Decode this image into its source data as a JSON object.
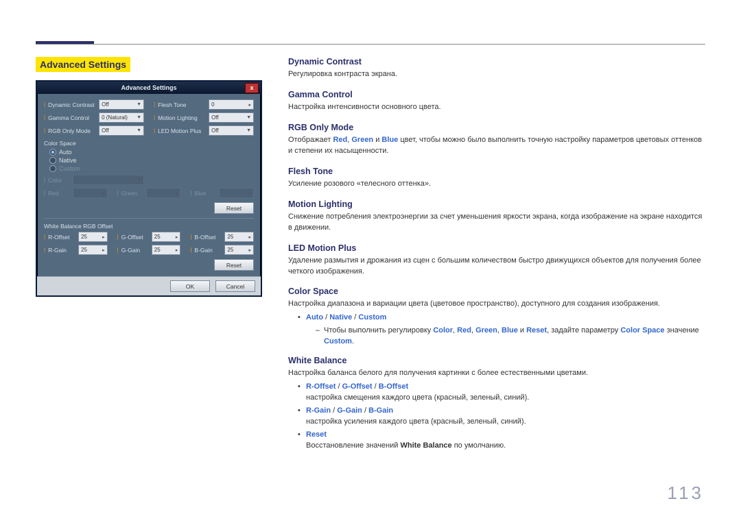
{
  "page_number": "113",
  "section_title": "Advanced Settings",
  "dialog": {
    "title": "Advanced Settings",
    "close": "x",
    "fields": {
      "dynamic_contrast": {
        "label": "Dynamic Contrast",
        "value": "Off"
      },
      "flesh_tone": {
        "label": "Flesh Tone",
        "value": "0"
      },
      "gamma_control": {
        "label": "Gamma Control",
        "value": "0 (Natural)"
      },
      "motion_lighting": {
        "label": "Motion Lighting",
        "value": "Off"
      },
      "rgb_only_mode": {
        "label": "RGB Only Mode",
        "value": "Off"
      },
      "led_motion_plus": {
        "label": "LED Motion Plus",
        "value": "Off"
      }
    },
    "color_space": {
      "header": "Color Space",
      "auto": "Auto",
      "native": "Native",
      "custom": "Custom",
      "color_label": "Color",
      "red_label": "Red",
      "green_label": "Green",
      "blue_label": "Blue",
      "reset": "Reset"
    },
    "white_balance": {
      "header": "White Balance RGB Offset",
      "r_offset": {
        "label": "R-Offset",
        "value": "25"
      },
      "g_offset": {
        "label": "G-Offset",
        "value": "25"
      },
      "b_offset": {
        "label": "B-Offset",
        "value": "25"
      },
      "r_gain": {
        "label": "R-Gain",
        "value": "25"
      },
      "g_gain": {
        "label": "G-Gain",
        "value": "25"
      },
      "b_gain": {
        "label": "B-Gain",
        "value": "25"
      },
      "reset": "Reset"
    },
    "ok": "OK",
    "cancel": "Cancel"
  },
  "descriptions": {
    "dynamic_contrast": {
      "title": "Dynamic Contrast",
      "text": "Регулировка контраста экрана."
    },
    "gamma_control": {
      "title": "Gamma Control",
      "text": "Настройка интенсивности основного цвета."
    },
    "rgb_only": {
      "title": "RGB Only Mode",
      "pre": "Отображает ",
      "red": "Red",
      "sep1": ", ",
      "green": "Green",
      "sep2": " и ",
      "blue": "Blue",
      "post": " цвет, чтобы можно было выполнить точную настройку параметров цветовых оттенков и степени их насыщенности."
    },
    "flesh_tone": {
      "title": "Flesh Tone",
      "text": "Усиление розового «телесного оттенка»."
    },
    "motion_lighting": {
      "title": "Motion Lighting",
      "text": "Снижение потребления электроэнергии за счет уменьшения яркости экрана, когда изображение на экране находится в движении."
    },
    "led_motion_plus": {
      "title": "LED Motion Plus",
      "text": "Удаление размытия и дрожания из сцен с большим количеством быстро движущихся объектов для получения более четкого изображения."
    },
    "color_space": {
      "title": "Color Space",
      "text": "Настройка диапазона и вариации цвета (цветовое пространство), доступного для создания изображения.",
      "opt_auto": "Auto",
      "slash": " / ",
      "opt_native": "Native",
      "opt_custom": "Custom",
      "note_pre": "Чтобы выполнить регулировку ",
      "n_color": "Color",
      "c1": ", ",
      "n_red": "Red",
      "c2": ", ",
      "n_green": "Green",
      "c3": ", ",
      "n_blue": "Blue",
      "c4": " и ",
      "n_reset": "Reset",
      "note_mid": ", задайте параметру ",
      "n_cs": "Color Space",
      "note_post": " значение ",
      "n_custom": "Custom",
      "note_end": "."
    },
    "white_balance": {
      "title": "White Balance",
      "text": "Настройка баланса белого для получения картинки с более естественными цветами.",
      "b1a": "R-Offset",
      "slash": " / ",
      "b1b": "G-Offset",
      "b1c": "B-Offset",
      "b1_text": "настройка смещения каждого цвета (красный, зеленый, синий).",
      "b2a": "R-Gain",
      "b2b": "G-Gain",
      "b2c": "B-Gain",
      "b2_text": "настройка усиления каждого цвета (красный, зеленый, синий).",
      "b3a": "Reset",
      "b3_pre": "Восстановление значений ",
      "b3_wb": "White Balance",
      "b3_post": " по умолчанию."
    }
  }
}
